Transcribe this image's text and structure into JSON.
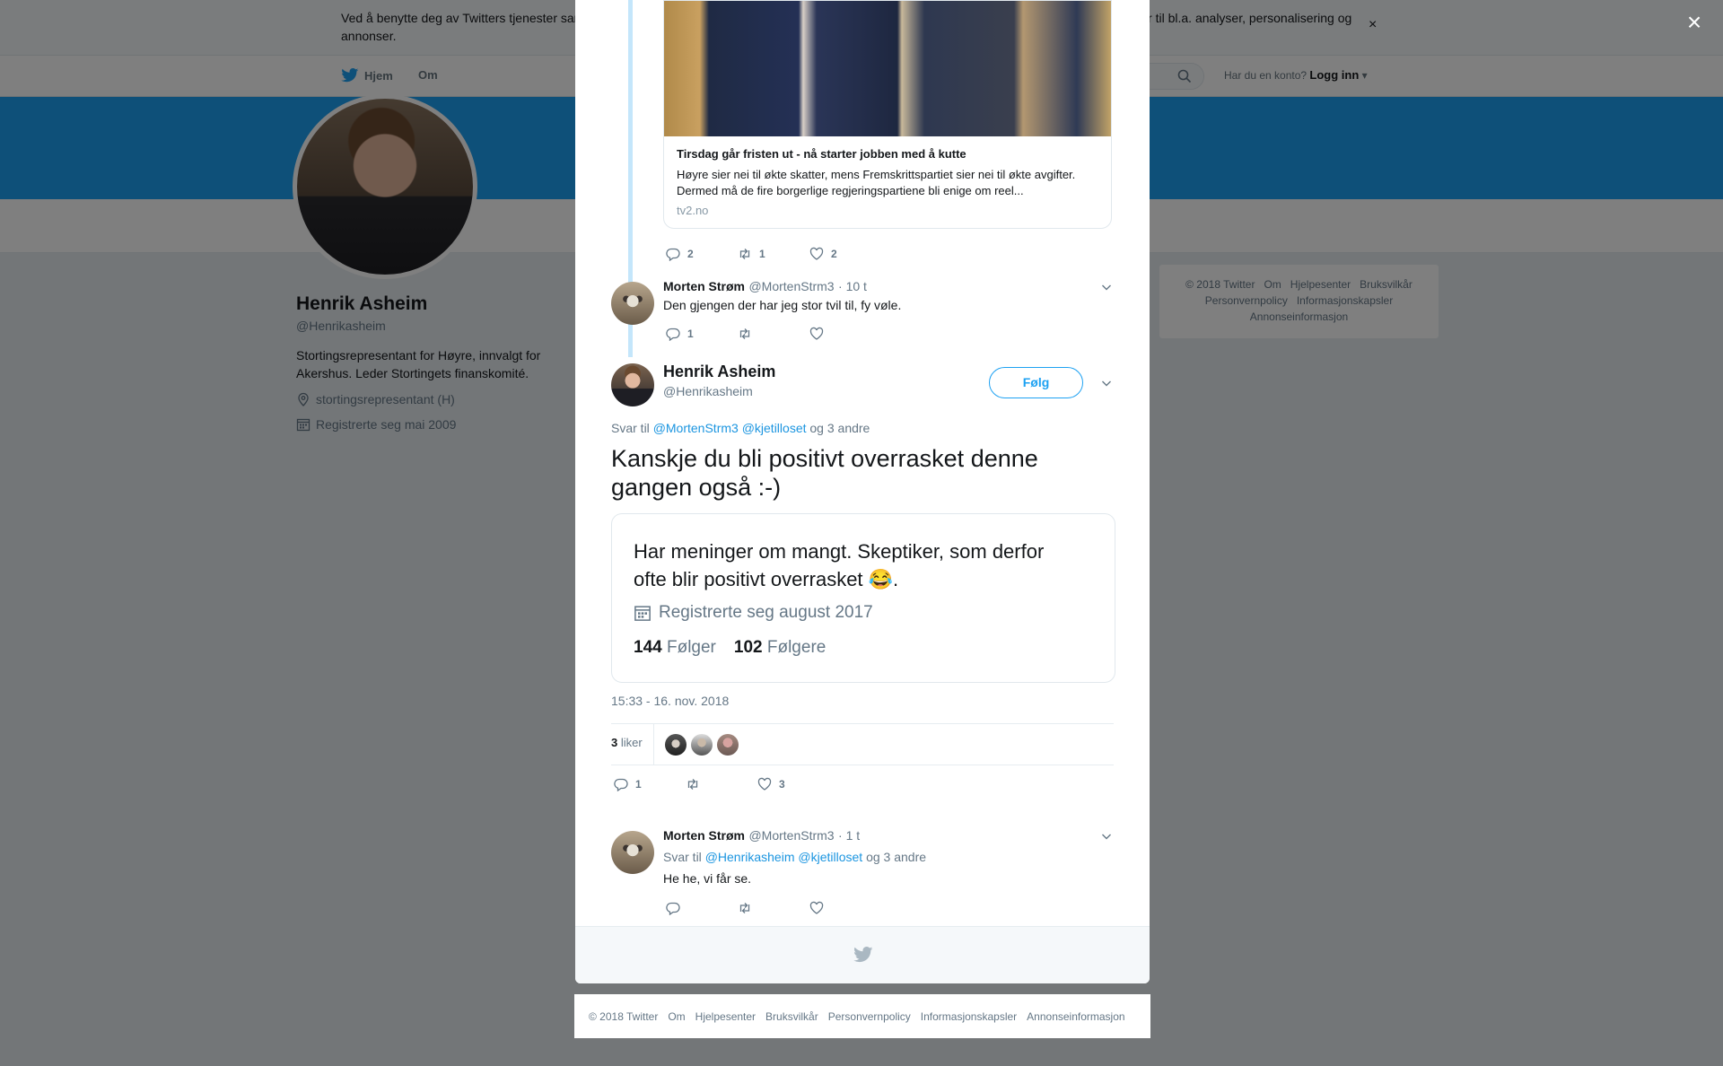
{
  "cookie": {
    "text": "Ved å benytte deg av Twitters tjenester samtykker du til vår bruk av informasjonskapsler og data. Vi og våre partnere benytter informasjonskapsler til bl.a. analyser, personalisering og annonser.",
    "close": "×"
  },
  "nav": {
    "home": "Hjem",
    "about": "Om",
    "login_prompt": "Har du en konto?",
    "login": "Logg inn"
  },
  "profile": {
    "name": "Henrik Asheim",
    "handle": "@Henrikasheim",
    "bio": "Stortingsrepresentant for Høyre, innvalgt for Akershus. Leder Stortingets finanskomité.",
    "location": "stortingsrepresentant (H)",
    "joined": "Registrerte seg mai 2009"
  },
  "side_footer": {
    "links": [
      "© 2018 Twitter",
      "Om",
      "Hjelpesenter",
      "Bruksvilkår",
      "Personvernpolicy",
      "Informasjonskapsler",
      "Annonseinformasjon"
    ]
  },
  "overlay": {
    "close": "×"
  },
  "card": {
    "title": "Tirsdag går fristen ut - nå starter jobben med å kutte",
    "description": "Høyre sier nei til økte skatter, mens Fremskrittspartiet sier nei til økte avgifter. Dermed må de fire borgerlige regjeringspartiene bli enige om reel...",
    "domain": "tv2.no"
  },
  "parent_actions": {
    "replies": "2",
    "retweets": "1",
    "likes": "2"
  },
  "reply1": {
    "name": "Morten Strøm",
    "handle": "@MortenStrm3",
    "time": "· 10 t",
    "text": "Den gjengen der har jeg stor tvil til, fy vøle.",
    "replies": "1",
    "retweets": "",
    "likes": ""
  },
  "main_tweet": {
    "name": "Henrik Asheim",
    "handle": "@Henrikasheim",
    "follow": "Følg",
    "reply_prefix": "Svar til",
    "reply_to_1": "@MortenStrm3",
    "reply_to_2": "@kjetilloset",
    "reply_suffix": "og 3 andre",
    "text": "Kanskje du bli positivt overrasket denne gangen også :-)",
    "timestamp": "15:33 - 16. nov. 2018",
    "likes_count": "3",
    "likes_label": "liker",
    "replies": "1",
    "retweets": "",
    "likes": "3"
  },
  "screenshot": {
    "bio": "Har meninger om mangt. Skeptiker, som derfor ofte blir positivt overrasket 😂.",
    "joined": "Registrerte seg august 2017",
    "following_count": "144",
    "following_label": "Følger",
    "followers_count": "102",
    "followers_label": "Følgere"
  },
  "reply2": {
    "name": "Morten Strøm",
    "handle": "@MortenStrm3",
    "time": "· 1 t",
    "reply_prefix": "Svar til",
    "reply_to_1": "@Henrikasheim",
    "reply_to_2": "@kjetilloset",
    "reply_suffix": "og 3 andre",
    "text": "He he, vi får se."
  },
  "bottom_footer": {
    "links": [
      "© 2018 Twitter",
      "Om",
      "Hjelpesenter",
      "Bruksvilkår",
      "Personvernpolicy",
      "Informasjonskapsler",
      "Annonseinformasjon"
    ]
  },
  "colors": {
    "twitter_blue": "#1da1f2",
    "link_blue": "#1b95e0",
    "thread_line": "#c4e6fb"
  }
}
